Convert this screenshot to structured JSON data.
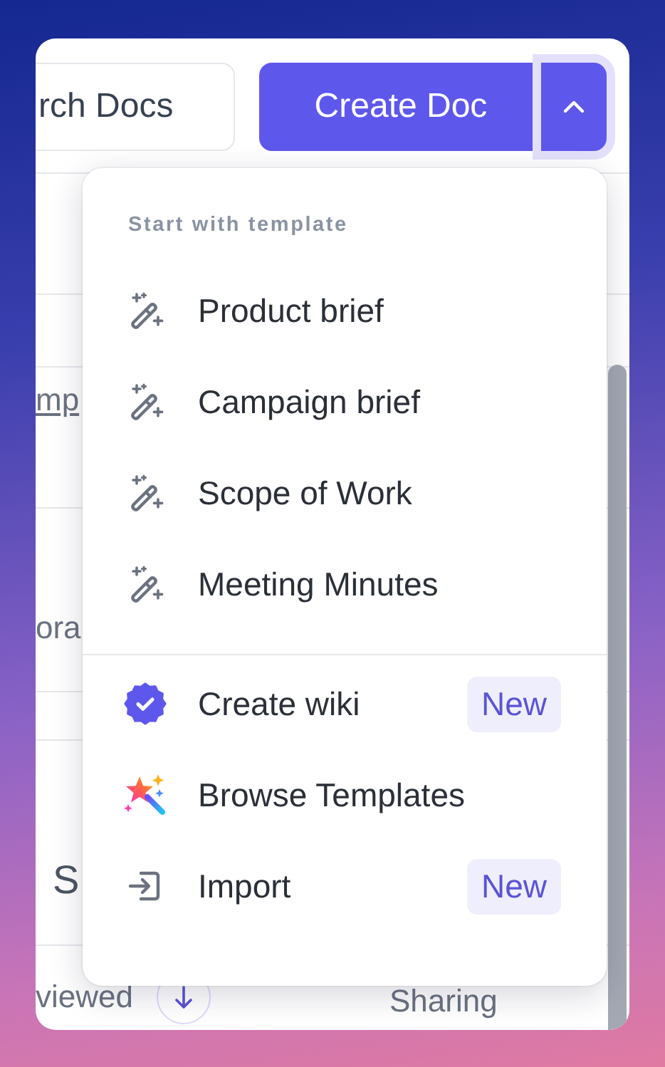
{
  "toolbar": {
    "search_button": {
      "label": "rch Docs"
    },
    "create_button": {
      "label": "Create Doc"
    },
    "menu_toggle": {
      "expanded": true
    }
  },
  "rows": [
    {
      "kind": "blank"
    },
    {
      "kind": "blank"
    },
    {
      "kind": "link",
      "text": "mp"
    },
    {
      "kind": "text",
      "text": "ora"
    },
    {
      "kind": "blank"
    },
    {
      "kind": "title",
      "text": "S"
    }
  ],
  "footer": {
    "columns": [
      {
        "label": "viewed",
        "sorted": true
      },
      {
        "label": "Sharing",
        "sorted": false
      }
    ]
  },
  "menu": {
    "section_label": "Start with template",
    "templates": [
      {
        "label": "Product brief"
      },
      {
        "label": "Campaign brief"
      },
      {
        "label": "Scope of Work"
      },
      {
        "label": "Meeting Minutes"
      }
    ],
    "actions": [
      {
        "kind": "wiki",
        "label": "Create wiki",
        "badge": "New"
      },
      {
        "kind": "browse",
        "label": "Browse Templates"
      },
      {
        "kind": "import",
        "label": "Import",
        "badge": "New"
      }
    ]
  }
}
